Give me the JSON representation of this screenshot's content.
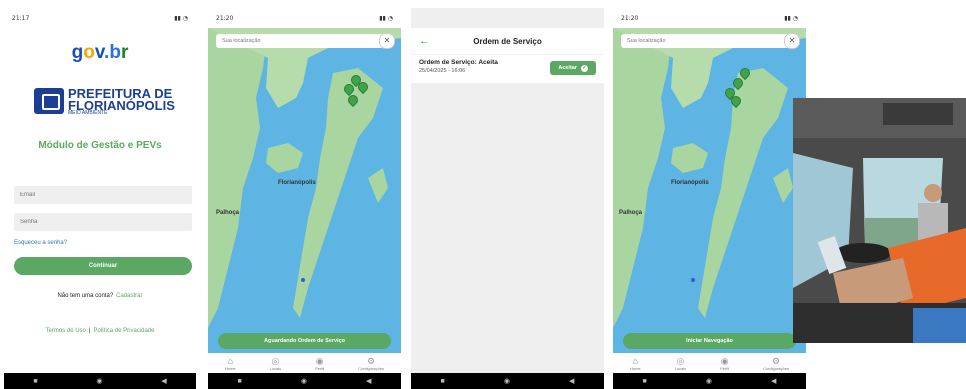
{
  "statusbar": {
    "s1_time": "21:17",
    "s2_time": "21:20",
    "s4_time": "21:20"
  },
  "login": {
    "logo": "gov.br",
    "pref_line1": "PREFEITURA DE",
    "pref_line2": "FLORIANÓPOLIS",
    "pref_line3": "MEIO AMBIENTE",
    "module_title": "Módulo de Gestão e PEVs",
    "email_placeholder": "Email",
    "password_placeholder": "Senha",
    "forgot": "Esqueceu a senha?",
    "continue": "Continuar",
    "no_account": "Não tem uma conta?",
    "register": "Cadastrar",
    "terms": "Termos de Uso",
    "privacy": "Política de Privacidade"
  },
  "map1": {
    "search_placeholder": "Sua localização",
    "city_label": "Florianópolis",
    "town_label": "Palhoça",
    "action_button": "Aguardando Ordem de Serviço"
  },
  "map2": {
    "search_placeholder": "Sua localização",
    "city_label": "Florianópolis",
    "town_label": "Palhoça",
    "action_button": "Iniciar Navegação"
  },
  "tabs": [
    "Home",
    "Locais",
    "Perfil",
    "Configurações"
  ],
  "orders": {
    "title": "Ordem de Serviço",
    "item_title": "Ordem de Serviço: Aceita",
    "item_date": "25/04/2025 - 16:06",
    "accept_button": "Aceitar"
  },
  "colors": {
    "primary_green": "#5aa863",
    "water": "#5eb4e3",
    "land": "#a8d5a0"
  }
}
